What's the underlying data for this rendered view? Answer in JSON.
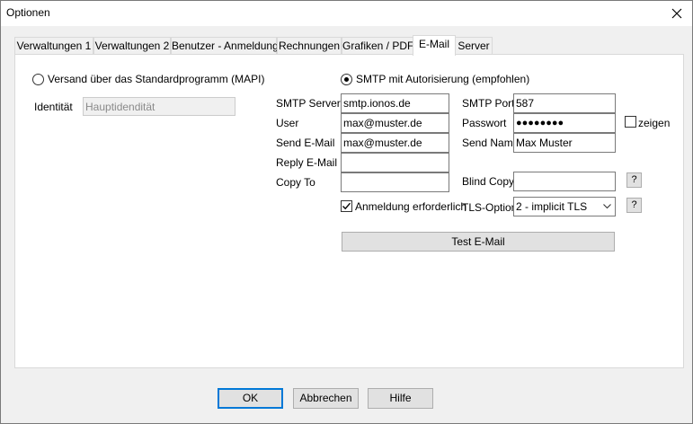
{
  "window": {
    "title": "Optionen"
  },
  "tabs": [
    {
      "label": "Verwaltungen 1"
    },
    {
      "label": "Verwaltungen 2"
    },
    {
      "label": "Benutzer - Anmeldung"
    },
    {
      "label": "Rechnungen"
    },
    {
      "label": "Grafiken / PDF"
    },
    {
      "label": "E-Mail",
      "active": true
    },
    {
      "label": "Server"
    }
  ],
  "mapi": {
    "radio_label": "Versand über das Standardprogramm (MAPI)",
    "selected": false,
    "identity_label": "Identität",
    "identity_placeholder": "Hauptidendität"
  },
  "smtp": {
    "radio_label": "SMTP mit Autorisierung (empfohlen)",
    "selected": true,
    "server_label": "SMTP Server",
    "server_value": "smtp.ionos.de",
    "port_label": "SMTP Port",
    "port_value": "587",
    "user_label": "User",
    "user_value": "max@muster.de",
    "password_label": "Passwort",
    "password_value": "●●●●●●●●",
    "show_label": "zeigen",
    "show_checked": false,
    "send_email_label": "Send E-Mail",
    "send_email_value": "max@muster.de",
    "send_name_label": "Send Name",
    "send_name_value": "Max Muster",
    "reply_email_label": "Reply E-Mail",
    "reply_email_value": "",
    "copy_to_label": "Copy To",
    "copy_to_value": "",
    "blind_copy_label": "Blind Copy",
    "blind_copy_value": "",
    "help_label": "?",
    "auth_label": "Anmeldung erforderlich",
    "auth_checked": true,
    "tls_label": "TLS-Option",
    "tls_value": "2 - implicit TLS",
    "test_button": "Test E-Mail"
  },
  "footer": {
    "ok": "OK",
    "cancel": "Abbrechen",
    "help": "Hilfe"
  }
}
